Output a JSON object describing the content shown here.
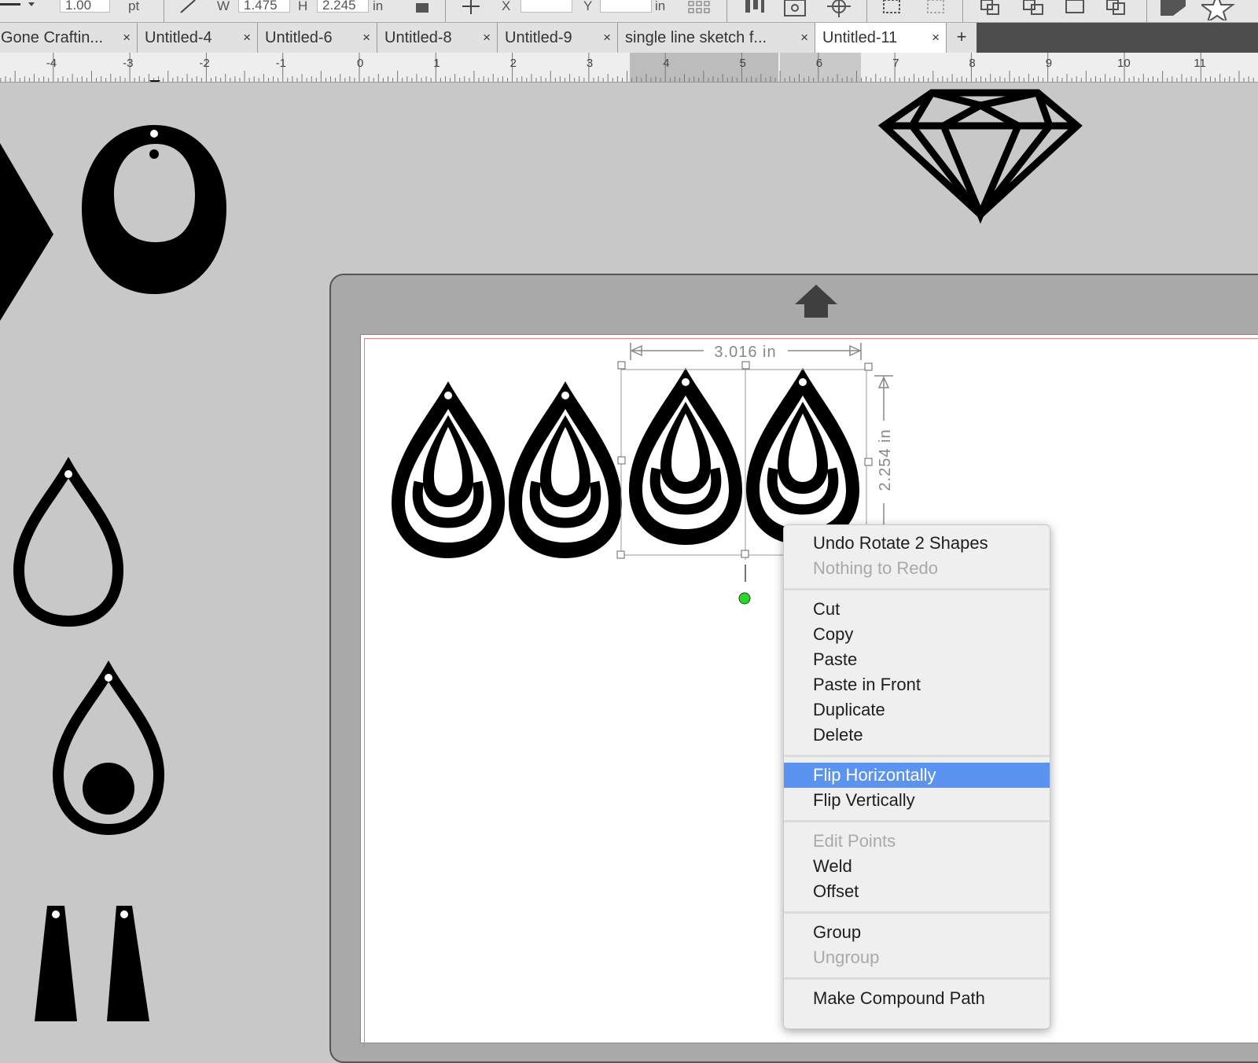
{
  "toolbar": {
    "stroke_value": "1.00",
    "stroke_unit": "pt",
    "w_label": "W",
    "w_value": "1.475",
    "h_label": "H",
    "h_value": "2.245",
    "size_unit": "in",
    "x_label": "X",
    "y_label": "Y",
    "pos_unit": "in"
  },
  "tabs": [
    {
      "label": "Gone Craftin..."
    },
    {
      "label": "Untitled-4"
    },
    {
      "label": "Untitled-6"
    },
    {
      "label": "Untitled-8"
    },
    {
      "label": "Untitled-9"
    },
    {
      "label": "single line sketch f..."
    },
    {
      "label": "Untitled-11",
      "active": true
    }
  ],
  "tab_close": "×",
  "tab_add": "+",
  "ruler": [
    "-4",
    "-3",
    "-2",
    "-1",
    "0",
    "1",
    "2",
    "3",
    "4",
    "5",
    "6",
    "7",
    "8",
    "9",
    "10",
    "11"
  ],
  "selection": {
    "width_label": "3.016 in",
    "height_label": "2.254 in"
  },
  "context_menu": {
    "items": [
      {
        "label": "Undo Rotate 2 Shapes",
        "enabled": true
      },
      {
        "label": "Nothing to Redo",
        "enabled": false
      },
      {
        "label": "Cut",
        "enabled": true
      },
      {
        "label": "Copy",
        "enabled": true
      },
      {
        "label": "Paste",
        "enabled": true
      },
      {
        "label": "Paste in Front",
        "enabled": true
      },
      {
        "label": "Duplicate",
        "enabled": true
      },
      {
        "label": "Delete",
        "enabled": true
      },
      {
        "label": "Flip Horizontally",
        "enabled": true,
        "highlighted": true
      },
      {
        "label": "Flip Vertically",
        "enabled": true
      },
      {
        "label": "Edit Points",
        "enabled": false
      },
      {
        "label": "Weld",
        "enabled": true
      },
      {
        "label": "Offset",
        "enabled": true
      },
      {
        "label": "Group",
        "enabled": true
      },
      {
        "label": "Ungroup",
        "enabled": false
      },
      {
        "label": "Make Compound Path",
        "enabled": true
      }
    ]
  },
  "colors": {
    "menu_highlight": "#5b93f1",
    "rotation_handle": "#22dd22",
    "mat_margin": "#e37f7f"
  }
}
